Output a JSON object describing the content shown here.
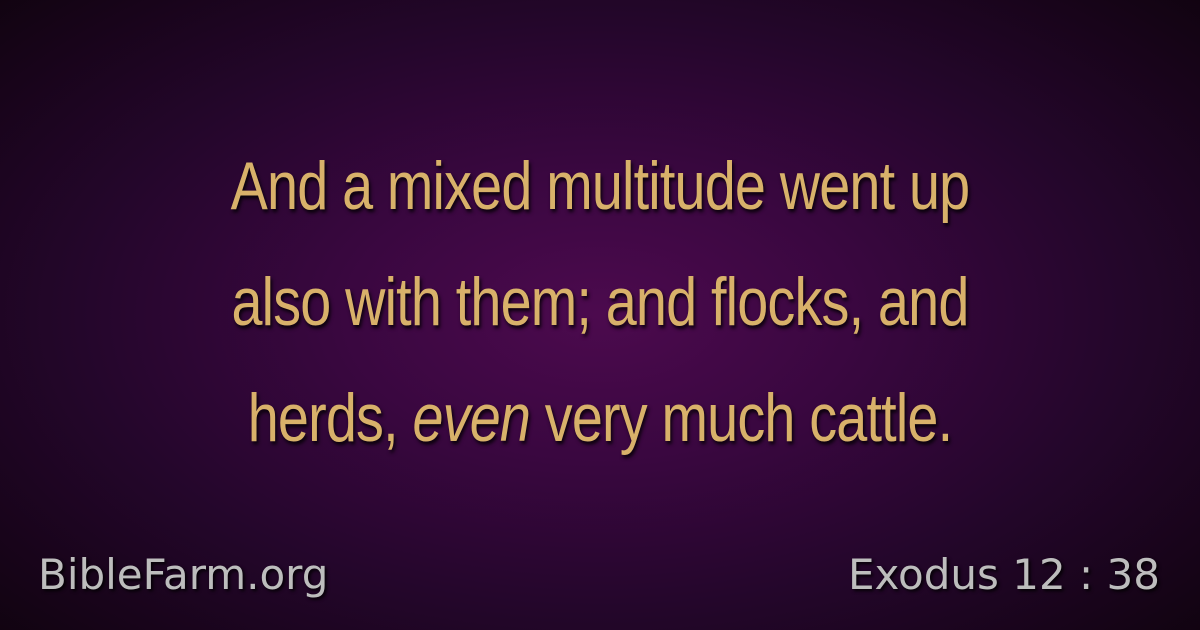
{
  "verse": {
    "line1": "And a mixed multitude went up",
    "line2": "also with them; and flocks, and",
    "line3_start": "herds,",
    "line3_italic": "even",
    "line3_end": "very much cattle."
  },
  "footer": {
    "site": "BibleFarm.org",
    "reference": "Exodus 12 : 38"
  },
  "colors": {
    "verse_text": "#d8b16a",
    "footer_text": "#bdbdbd",
    "background_center": "#4c0a4e",
    "background_edge": "#10030f"
  }
}
